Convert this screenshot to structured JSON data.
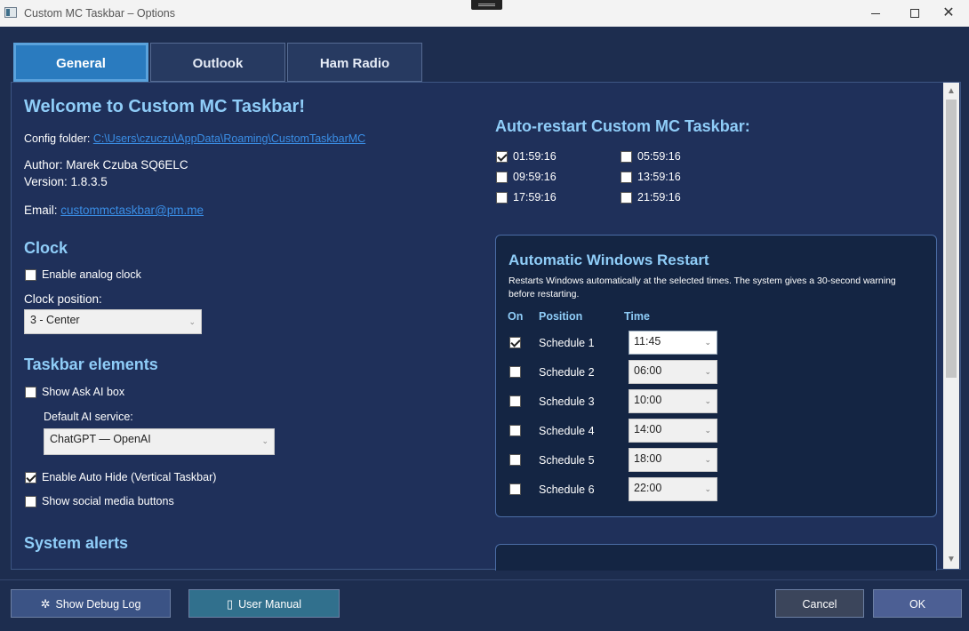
{
  "window": {
    "title": "Custom MC Taskbar – Options",
    "minimize": "",
    "maximize": "",
    "close": "✕"
  },
  "tabs": [
    {
      "label": "General",
      "active": true
    },
    {
      "label": "Outlook",
      "active": false
    },
    {
      "label": "Ham Radio",
      "active": false
    }
  ],
  "general": {
    "welcome": "Welcome to Custom MC Taskbar!",
    "config_label": "Config folder: ",
    "config_path": "C:\\Users\\czuczu\\AppData\\Roaming\\CustomTaskbarMC",
    "author": "Author: Marek Czuba SQ6ELC",
    "version": "Version: 1.8.3.5",
    "email_label": "Email: ",
    "email": "custommctaskbar@pm.me"
  },
  "clock": {
    "heading": "Clock",
    "enable_analog": {
      "label": "Enable analog clock",
      "checked": false
    },
    "position_label": "Clock position:",
    "position_value": "3 - Center"
  },
  "taskbar_elements": {
    "heading": "Taskbar elements",
    "show_ask_ai": {
      "label": "Show Ask AI box",
      "checked": false
    },
    "ai_service_label": "Default AI service:",
    "ai_service_value": "ChatGPT — OpenAI",
    "auto_hide": {
      "label": "Enable Auto Hide (Vertical Taskbar)",
      "checked": true
    },
    "social_buttons": {
      "label": "Show social media buttons",
      "checked": false
    }
  },
  "system_alerts": {
    "heading": "System alerts"
  },
  "auto_restart": {
    "heading": "Auto-restart Custom MC Taskbar:",
    "times": [
      {
        "label": "01:59:16",
        "checked": true
      },
      {
        "label": "05:59:16",
        "checked": false
      },
      {
        "label": "09:59:16",
        "checked": false
      },
      {
        "label": "13:59:16",
        "checked": false
      },
      {
        "label": "17:59:16",
        "checked": false
      },
      {
        "label": "21:59:16",
        "checked": false
      }
    ]
  },
  "windows_restart": {
    "heading": "Automatic Windows Restart",
    "description_line1": "Restarts Windows automatically at the selected times. The system gives a 30-second warning",
    "description_line2": "before restarting.",
    "col_on": "On",
    "col_position": "Position",
    "col_time": "Time",
    "schedules": [
      {
        "name": "Schedule 1",
        "time": "11:45",
        "checked": true
      },
      {
        "name": "Schedule 2",
        "time": "06:00",
        "checked": false
      },
      {
        "name": "Schedule 3",
        "time": "10:00",
        "checked": false
      },
      {
        "name": "Schedule 4",
        "time": "14:00",
        "checked": false
      },
      {
        "name": "Schedule 5",
        "time": "18:00",
        "checked": false
      },
      {
        "name": "Schedule 6",
        "time": "22:00",
        "checked": false
      }
    ]
  },
  "footer": {
    "debug_label": "Show Debug Log",
    "manual_label": "User Manual",
    "cancel_label": "Cancel",
    "ok_label": "OK"
  },
  "icons": {
    "debug": "gear-icon",
    "manual": "book-icon"
  }
}
